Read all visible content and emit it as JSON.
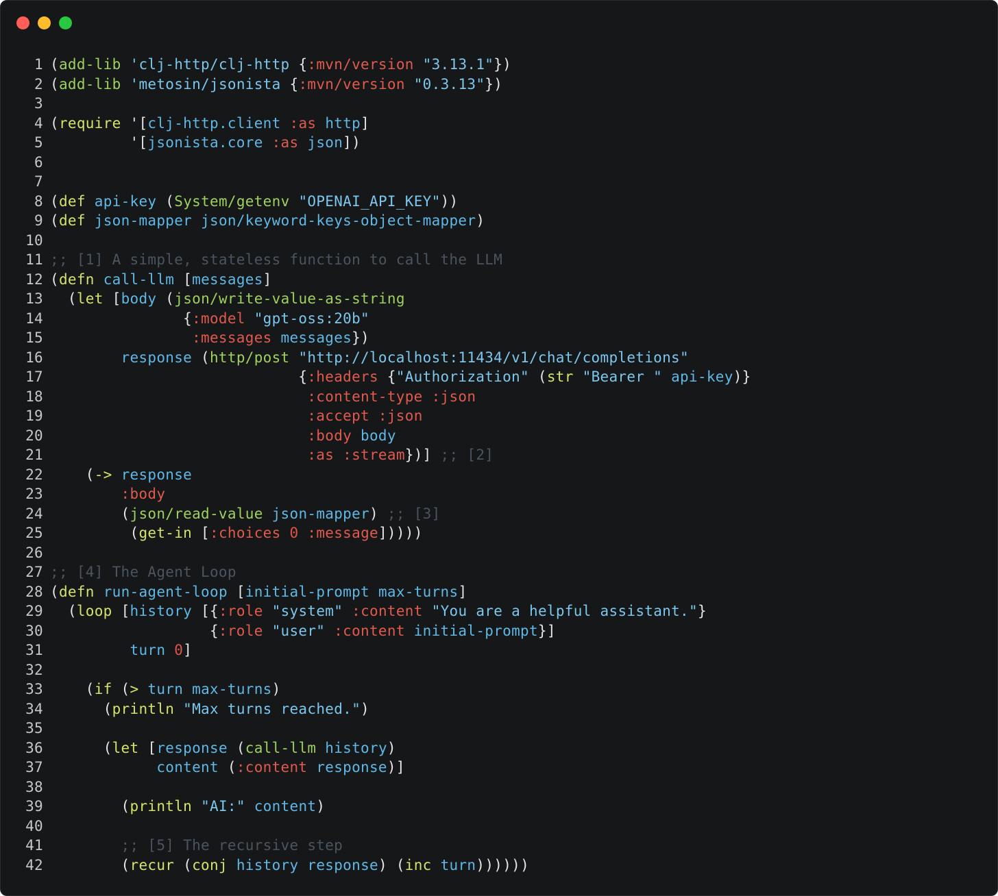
{
  "window": {
    "controls": [
      "close",
      "minimize",
      "maximize"
    ],
    "colors": {
      "close": "#ff5f57",
      "minimize": "#febc2e",
      "maximize": "#28c840",
      "background": "#151718"
    }
  },
  "code": {
    "language": "clojure",
    "lines": [
      {
        "n": "1",
        "tokens": [
          [
            "p",
            "("
          ],
          [
            "fn",
            "add-lib"
          ],
          [
            "p",
            " "
          ],
          [
            "s",
            "'clj-http/clj-http"
          ],
          [
            "p",
            " {"
          ],
          [
            "kw",
            ":mvn/version"
          ],
          [
            "p",
            " "
          ],
          [
            "s",
            "\"3.13.1\""
          ],
          [
            "p",
            "})"
          ]
        ]
      },
      {
        "n": "2",
        "tokens": [
          [
            "p",
            "("
          ],
          [
            "fn",
            "add-lib"
          ],
          [
            "p",
            " "
          ],
          [
            "s",
            "'metosin/jsonista"
          ],
          [
            "p",
            " {"
          ],
          [
            "kw",
            ":mvn/version"
          ],
          [
            "p",
            " "
          ],
          [
            "s",
            "\"0.3.13\""
          ],
          [
            "p",
            "})"
          ]
        ]
      },
      {
        "n": "3",
        "tokens": []
      },
      {
        "n": "4",
        "tokens": [
          [
            "p",
            "("
          ],
          [
            "f",
            "require"
          ],
          [
            "p",
            " '["
          ],
          [
            "v",
            "clj-http.client"
          ],
          [
            "p",
            " "
          ],
          [
            "kw",
            ":as"
          ],
          [
            "p",
            " "
          ],
          [
            "v",
            "http"
          ],
          [
            "p",
            "]"
          ]
        ]
      },
      {
        "n": "5",
        "tokens": [
          [
            "p",
            "         '["
          ],
          [
            "v",
            "jsonista.core"
          ],
          [
            "p",
            " "
          ],
          [
            "kw",
            ":as"
          ],
          [
            "p",
            " "
          ],
          [
            "v",
            "json"
          ],
          [
            "p",
            "])"
          ]
        ]
      },
      {
        "n": "6",
        "tokens": []
      },
      {
        "n": "7",
        "tokens": []
      },
      {
        "n": "8",
        "tokens": [
          [
            "p",
            "("
          ],
          [
            "f",
            "def"
          ],
          [
            "p",
            " "
          ],
          [
            "v",
            "api-key"
          ],
          [
            "p",
            " ("
          ],
          [
            "fn",
            "System/getenv"
          ],
          [
            "p",
            " "
          ],
          [
            "s",
            "\"OPENAI_API_KEY\""
          ],
          [
            "p",
            "))"
          ]
        ]
      },
      {
        "n": "9",
        "tokens": [
          [
            "p",
            "("
          ],
          [
            "f",
            "def"
          ],
          [
            "p",
            " "
          ],
          [
            "v",
            "json-mapper"
          ],
          [
            "p",
            " "
          ],
          [
            "v",
            "json/keyword-keys-object-mapper"
          ],
          [
            "p",
            ")"
          ]
        ]
      },
      {
        "n": "10",
        "tokens": []
      },
      {
        "n": "11",
        "tokens": [
          [
            "c",
            ";; [1] A simple, stateless function to call the LLM"
          ]
        ]
      },
      {
        "n": "12",
        "tokens": [
          [
            "p",
            "("
          ],
          [
            "f",
            "defn"
          ],
          [
            "p",
            " "
          ],
          [
            "v",
            "call-llm"
          ],
          [
            "p",
            " ["
          ],
          [
            "v",
            "messages"
          ],
          [
            "p",
            "]"
          ]
        ]
      },
      {
        "n": "13",
        "tokens": [
          [
            "p",
            "  ("
          ],
          [
            "f",
            "let"
          ],
          [
            "p",
            " ["
          ],
          [
            "v",
            "body"
          ],
          [
            "p",
            " ("
          ],
          [
            "fn",
            "json/write-value-as-string"
          ]
        ]
      },
      {
        "n": "14",
        "tokens": [
          [
            "p",
            "               {"
          ],
          [
            "kw",
            ":model"
          ],
          [
            "p",
            " "
          ],
          [
            "s",
            "\"gpt-oss:20b\""
          ]
        ]
      },
      {
        "n": "15",
        "tokens": [
          [
            "p",
            "                "
          ],
          [
            "kw",
            ":messages"
          ],
          [
            "p",
            " "
          ],
          [
            "v",
            "messages"
          ],
          [
            "p",
            "})"
          ]
        ]
      },
      {
        "n": "16",
        "tokens": [
          [
            "p",
            "        "
          ],
          [
            "v",
            "response"
          ],
          [
            "p",
            " ("
          ],
          [
            "fn",
            "http/post"
          ],
          [
            "p",
            " "
          ],
          [
            "s",
            "\"http://localhost:11434/v1/chat/completions\""
          ]
        ]
      },
      {
        "n": "17",
        "tokens": [
          [
            "p",
            "                            {"
          ],
          [
            "kw",
            ":headers"
          ],
          [
            "p",
            " {"
          ],
          [
            "s",
            "\"Authorization\""
          ],
          [
            "p",
            " ("
          ],
          [
            "f",
            "str"
          ],
          [
            "p",
            " "
          ],
          [
            "s",
            "\"Bearer \""
          ],
          [
            "p",
            " "
          ],
          [
            "v",
            "api-key"
          ],
          [
            "p",
            ")}"
          ]
        ]
      },
      {
        "n": "18",
        "tokens": [
          [
            "p",
            "                             "
          ],
          [
            "kw",
            ":content-type"
          ],
          [
            "p",
            " "
          ],
          [
            "kw",
            ":json"
          ]
        ]
      },
      {
        "n": "19",
        "tokens": [
          [
            "p",
            "                             "
          ],
          [
            "kw",
            ":accept"
          ],
          [
            "p",
            " "
          ],
          [
            "kw",
            ":json"
          ]
        ]
      },
      {
        "n": "20",
        "tokens": [
          [
            "p",
            "                             "
          ],
          [
            "kw",
            ":body"
          ],
          [
            "p",
            " "
          ],
          [
            "v",
            "body"
          ]
        ]
      },
      {
        "n": "21",
        "tokens": [
          [
            "p",
            "                             "
          ],
          [
            "kw",
            ":as"
          ],
          [
            "p",
            " "
          ],
          [
            "kw",
            ":stream"
          ],
          [
            "p",
            "})] "
          ],
          [
            "c",
            ";; [2]"
          ]
        ]
      },
      {
        "n": "22",
        "tokens": [
          [
            "p",
            "    ("
          ],
          [
            "f",
            "->"
          ],
          [
            "p",
            " "
          ],
          [
            "v",
            "response"
          ]
        ]
      },
      {
        "n": "23",
        "tokens": [
          [
            "p",
            "        "
          ],
          [
            "kw",
            ":body"
          ]
        ]
      },
      {
        "n": "24",
        "tokens": [
          [
            "p",
            "        ("
          ],
          [
            "fn",
            "json/read-value"
          ],
          [
            "p",
            " "
          ],
          [
            "v",
            "json-mapper"
          ],
          [
            "p",
            ") "
          ],
          [
            "c",
            ";; [3]"
          ]
        ]
      },
      {
        "n": "25",
        "tokens": [
          [
            "p",
            "         ("
          ],
          [
            "f",
            "get-in"
          ],
          [
            "p",
            " ["
          ],
          [
            "kw",
            ":choices"
          ],
          [
            "p",
            " "
          ],
          [
            "n",
            "0"
          ],
          [
            "p",
            " "
          ],
          [
            "kw",
            ":message"
          ],
          [
            "p",
            "]))))"
          ]
        ]
      },
      {
        "n": "26",
        "tokens": []
      },
      {
        "n": "27",
        "tokens": [
          [
            "c",
            ";; [4] The Agent Loop"
          ]
        ]
      },
      {
        "n": "28",
        "tokens": [
          [
            "p",
            "("
          ],
          [
            "f",
            "defn"
          ],
          [
            "p",
            " "
          ],
          [
            "v",
            "run-agent-loop"
          ],
          [
            "p",
            " ["
          ],
          [
            "v",
            "initial-prompt"
          ],
          [
            "p",
            " "
          ],
          [
            "v",
            "max-turns"
          ],
          [
            "p",
            "]"
          ]
        ]
      },
      {
        "n": "29",
        "tokens": [
          [
            "p",
            "  ("
          ],
          [
            "f",
            "loop"
          ],
          [
            "p",
            " ["
          ],
          [
            "v",
            "history"
          ],
          [
            "p",
            " [{"
          ],
          [
            "kw",
            ":role"
          ],
          [
            "p",
            " "
          ],
          [
            "s",
            "\"system\""
          ],
          [
            "p",
            " "
          ],
          [
            "kw",
            ":content"
          ],
          [
            "p",
            " "
          ],
          [
            "s",
            "\"You are a helpful assistant.\""
          ],
          [
            "p",
            "}"
          ]
        ]
      },
      {
        "n": "30",
        "tokens": [
          [
            "p",
            "                  {"
          ],
          [
            "kw",
            ":role"
          ],
          [
            "p",
            " "
          ],
          [
            "s",
            "\"user\""
          ],
          [
            "p",
            " "
          ],
          [
            "kw",
            ":content"
          ],
          [
            "p",
            " "
          ],
          [
            "v",
            "initial-prompt"
          ],
          [
            "p",
            "}]"
          ]
        ]
      },
      {
        "n": "31",
        "tokens": [
          [
            "p",
            "         "
          ],
          [
            "v",
            "turn"
          ],
          [
            "p",
            " "
          ],
          [
            "n",
            "0"
          ],
          [
            "p",
            "]"
          ]
        ]
      },
      {
        "n": "32",
        "tokens": []
      },
      {
        "n": "33",
        "tokens": [
          [
            "p",
            "    ("
          ],
          [
            "f",
            "if"
          ],
          [
            "p",
            " ("
          ],
          [
            "f",
            ">"
          ],
          [
            "p",
            " "
          ],
          [
            "v",
            "turn"
          ],
          [
            "p",
            " "
          ],
          [
            "v",
            "max-turns"
          ],
          [
            "p",
            ")"
          ]
        ]
      },
      {
        "n": "34",
        "tokens": [
          [
            "p",
            "      ("
          ],
          [
            "f",
            "println"
          ],
          [
            "p",
            " "
          ],
          [
            "s",
            "\"Max turns reached.\""
          ],
          [
            "p",
            ")"
          ]
        ]
      },
      {
        "n": "35",
        "tokens": []
      },
      {
        "n": "36",
        "tokens": [
          [
            "p",
            "      ("
          ],
          [
            "f",
            "let"
          ],
          [
            "p",
            " ["
          ],
          [
            "v",
            "response"
          ],
          [
            "p",
            " ("
          ],
          [
            "fn",
            "call-llm"
          ],
          [
            "p",
            " "
          ],
          [
            "v",
            "history"
          ],
          [
            "p",
            ")"
          ]
        ]
      },
      {
        "n": "37",
        "tokens": [
          [
            "p",
            "            "
          ],
          [
            "v",
            "content"
          ],
          [
            "p",
            " ("
          ],
          [
            "kw",
            ":content"
          ],
          [
            "p",
            " "
          ],
          [
            "v",
            "response"
          ],
          [
            "p",
            ")]"
          ]
        ]
      },
      {
        "n": "38",
        "tokens": []
      },
      {
        "n": "39",
        "tokens": [
          [
            "p",
            "        ("
          ],
          [
            "f",
            "println"
          ],
          [
            "p",
            " "
          ],
          [
            "s",
            "\"AI:\""
          ],
          [
            "p",
            " "
          ],
          [
            "v",
            "content"
          ],
          [
            "p",
            ")"
          ]
        ]
      },
      {
        "n": "40",
        "tokens": []
      },
      {
        "n": "41",
        "tokens": [
          [
            "p",
            "        "
          ],
          [
            "c",
            ";; [5] The recursive step"
          ]
        ]
      },
      {
        "n": "42",
        "tokens": [
          [
            "p",
            "        ("
          ],
          [
            "f",
            "recur"
          ],
          [
            "p",
            " ("
          ],
          [
            "f",
            "conj"
          ],
          [
            "p",
            " "
          ],
          [
            "v",
            "history"
          ],
          [
            "p",
            " "
          ],
          [
            "v",
            "response"
          ],
          [
            "p",
            ") ("
          ],
          [
            "f",
            "inc"
          ],
          [
            "p",
            " "
          ],
          [
            "v",
            "turn"
          ],
          [
            "p",
            "))))))"
          ]
        ]
      }
    ]
  }
}
